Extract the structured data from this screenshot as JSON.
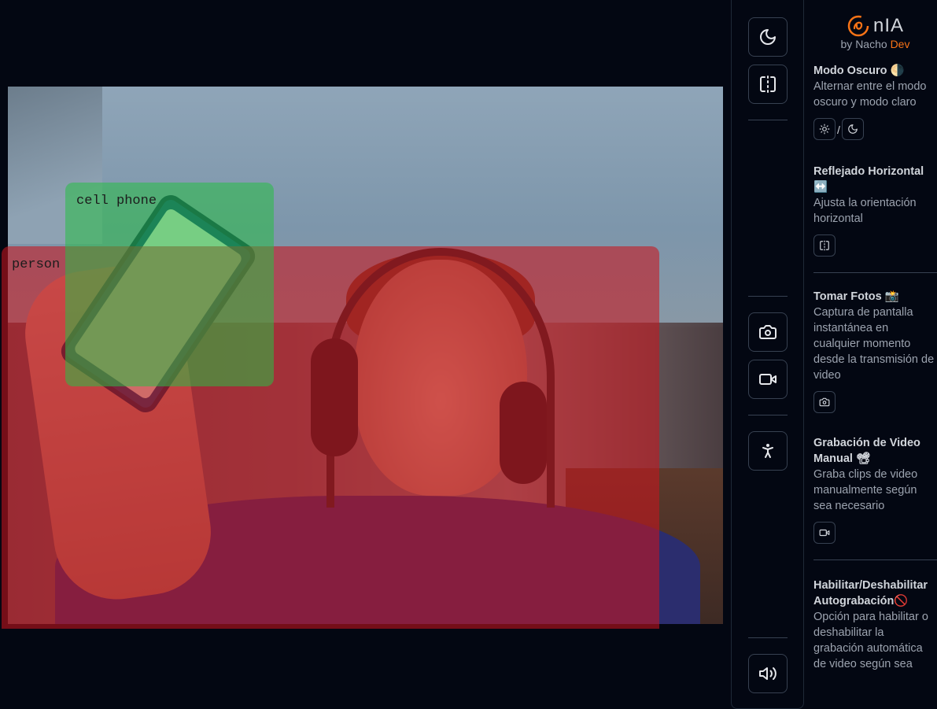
{
  "detections": [
    {
      "label": "person",
      "color": "#c8141e"
    },
    {
      "label": "cell phone",
      "color": "#28be46"
    }
  ],
  "toolbar": {
    "buttons": [
      {
        "name": "dark-mode-button",
        "icon": "moon-icon"
      },
      {
        "name": "mirror-button",
        "icon": "flip-horizontal-icon"
      },
      {
        "name": "take-photo-button",
        "icon": "camera-icon"
      },
      {
        "name": "record-video-button",
        "icon": "video-icon"
      },
      {
        "name": "accessibility-button",
        "icon": "person-standing-icon"
      },
      {
        "name": "volume-button",
        "icon": "volume-icon"
      }
    ]
  },
  "brand": {
    "logo_text": "nIA",
    "by_prefix": "by Nacho ",
    "by_accent": "Dev",
    "accent_color": "#f97316"
  },
  "sections": {
    "dark": {
      "title": "Modo Oscuro 🌗",
      "desc": "Alternar entre el modo oscuro y modo claro",
      "separator": "/"
    },
    "mirror": {
      "title": "Reflejado Horizontal ↔️",
      "desc": "Ajusta la orientación horizontal"
    },
    "photo": {
      "title": "Tomar Fotos 📸",
      "desc": "Captura de pantalla instantánea en cualquier momento desde la transmisión de video"
    },
    "video": {
      "title": "Grabación de Video Manual 📽",
      "desc": "Graba clips de video manualmente según sea necesario"
    },
    "auto": {
      "title": "Habilitar/Deshabilitar Autograbación🚫",
      "desc": "Opción para habilitar o deshabilitar la grabación automática de video según sea"
    }
  }
}
